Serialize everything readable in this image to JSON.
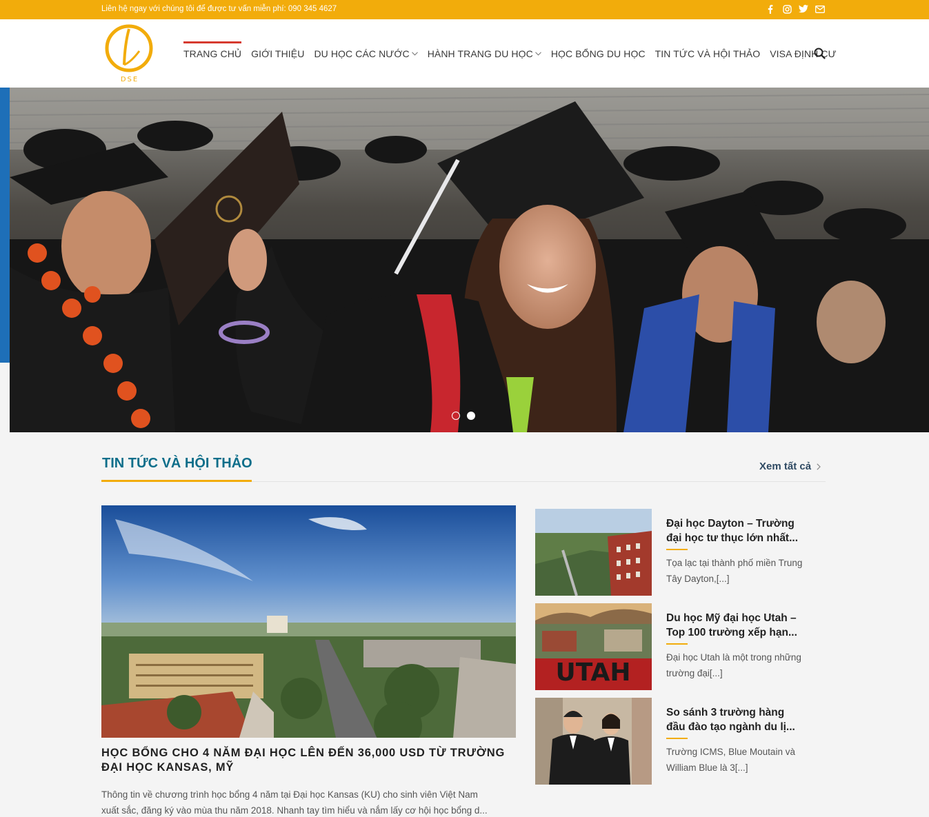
{
  "topbar": {
    "message": "Liên hệ ngay với chúng tôi để được tư vấn miễn phí: 090 345 4627",
    "social_icons": [
      "facebook-icon",
      "instagram-icon",
      "twitter-icon",
      "email-icon"
    ]
  },
  "logo": {
    "text": "DSE"
  },
  "nav": {
    "items": [
      {
        "label": "TRANG CHỦ",
        "active": true
      },
      {
        "label": "GIỚI THIỆU"
      },
      {
        "label": "DU HỌC CÁC NƯỚC",
        "has_dropdown": true
      },
      {
        "label": "HÀNH TRANG DU HỌC",
        "has_dropdown": true
      },
      {
        "label": "HỌC BỔNG DU HỌC"
      },
      {
        "label": "TIN TỨC VÀ HỘI THẢO"
      },
      {
        "label": "VISA ĐỊNH CƯ"
      }
    ]
  },
  "slider": {
    "current_slide": 2,
    "total_slides": 2
  },
  "section": {
    "title": "TIN TỨC VÀ HỘI THẢO",
    "see_all": "Xem tất cả"
  },
  "main_article": {
    "title": "HỌC BỔNG CHO 4 NĂM ĐẠI HỌC LÊN ĐẾN 36,000 USD TỪ TRƯỜNG ĐẠI HỌC KANSAS, MỸ",
    "desc_line1": "Thông tin về chương trình học bổng 4 năm tại Đại học Kansas (KU) cho sinh viên Việt Nam",
    "desc_line2": "xuất sắc, đăng ký vào mùa thu năm 2018. Nhanh tay tìm hiểu và nắm lấy cơ hội học bổng d..."
  },
  "side_articles": [
    {
      "title_line1": "Đại học Dayton – Trường",
      "title_line2": "đại học tư thục lớn nhất...",
      "desc": "Tọa lạc tại thành phố miền Trung Tây Dayton,[...]"
    },
    {
      "title_line1": "Du học Mỹ đại học Utah –",
      "title_line2": "Top 100 trường xếp hạn...",
      "desc": "Đại học Utah là một trong những trường đại[...]",
      "thumb_text": "UTAH"
    },
    {
      "title_line1": "So sánh 3 trường hàng",
      "title_line2": "đầu đào tạo ngành du lị...",
      "desc": "Trường ICMS, Blue Moutain và William Blue là 3[...]"
    }
  ]
}
